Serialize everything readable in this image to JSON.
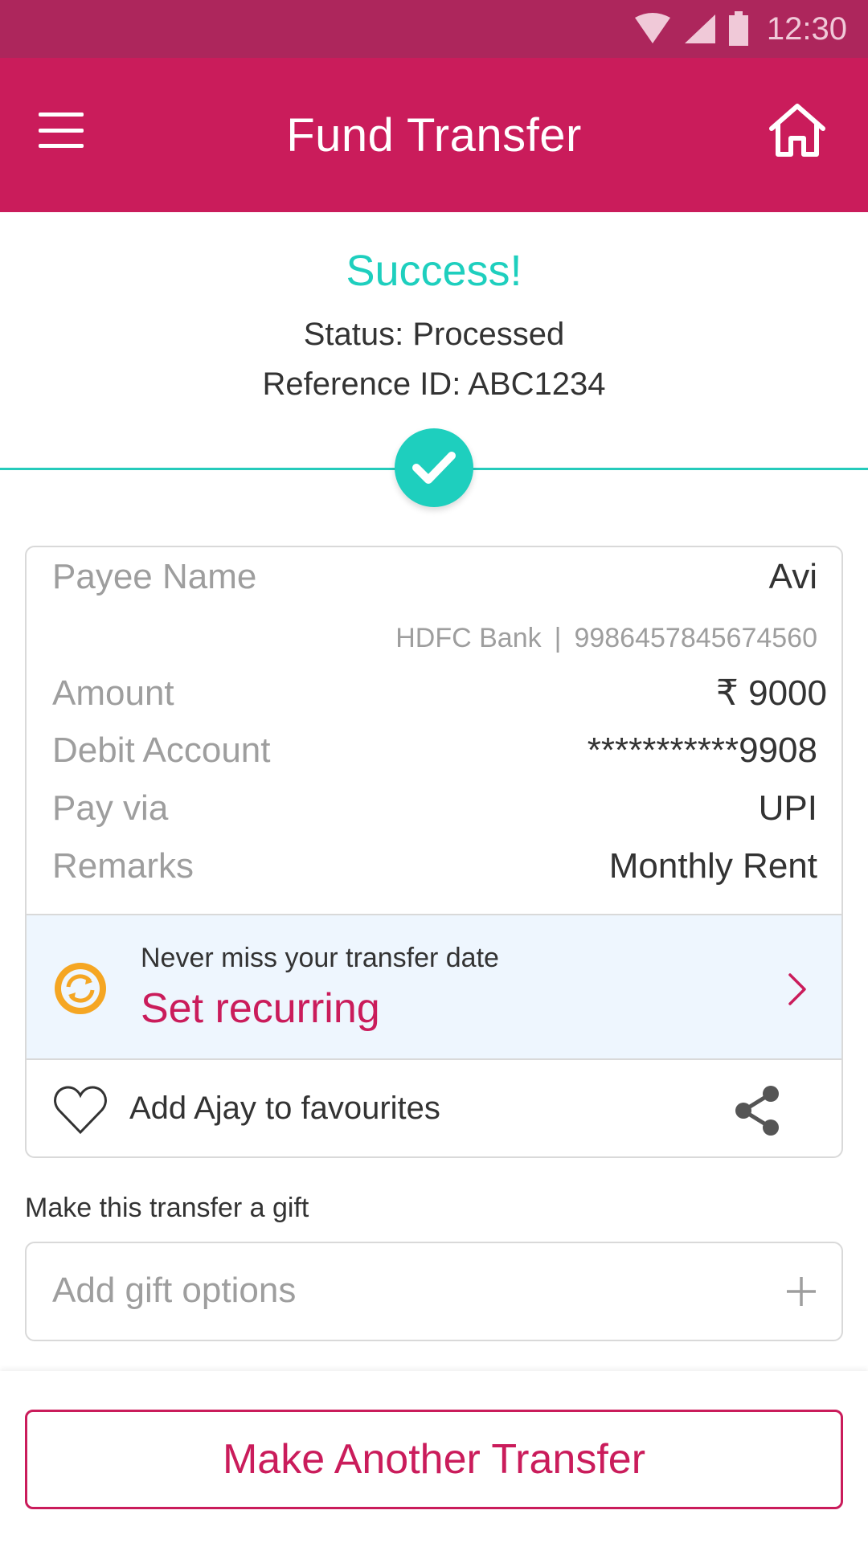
{
  "status_bar": {
    "time": "12:30"
  },
  "app_bar": {
    "title": "Fund Transfer"
  },
  "result": {
    "heading": "Success!",
    "status": "Status: Processed",
    "reference": "Reference ID: ABC1234"
  },
  "details": {
    "payee_label": "Payee Name",
    "payee_value": "Avi",
    "bank_name": "HDFC Bank",
    "separator": "|",
    "account_number": "9986457845674560",
    "amount_label": "Amount",
    "amount_value": "₹ 9000",
    "debit_label": "Debit Account",
    "debit_value": "***********9908",
    "payvia_label": "Pay via",
    "payvia_value": "UPI",
    "remarks_label": "Remarks",
    "remarks_value": "Monthly Rent"
  },
  "recurring": {
    "hint": "Never miss your transfer date",
    "action": "Set recurring"
  },
  "favourite": {
    "label": "Add Ajay to favourites"
  },
  "gift": {
    "caption": "Make this transfer a gift",
    "placeholder": "Add gift options"
  },
  "cta": {
    "label": "Make Another Transfer"
  },
  "colors": {
    "brand": "#ca1c5b",
    "status_bar": "#ad265c",
    "success": "#1ecfbe",
    "recurring_icon": "#f5a623"
  },
  "icons": [
    "menu-icon",
    "home-icon",
    "check-icon",
    "recurring-icon",
    "chevron-right-icon",
    "heart-icon",
    "share-icon",
    "plus-icon"
  ]
}
